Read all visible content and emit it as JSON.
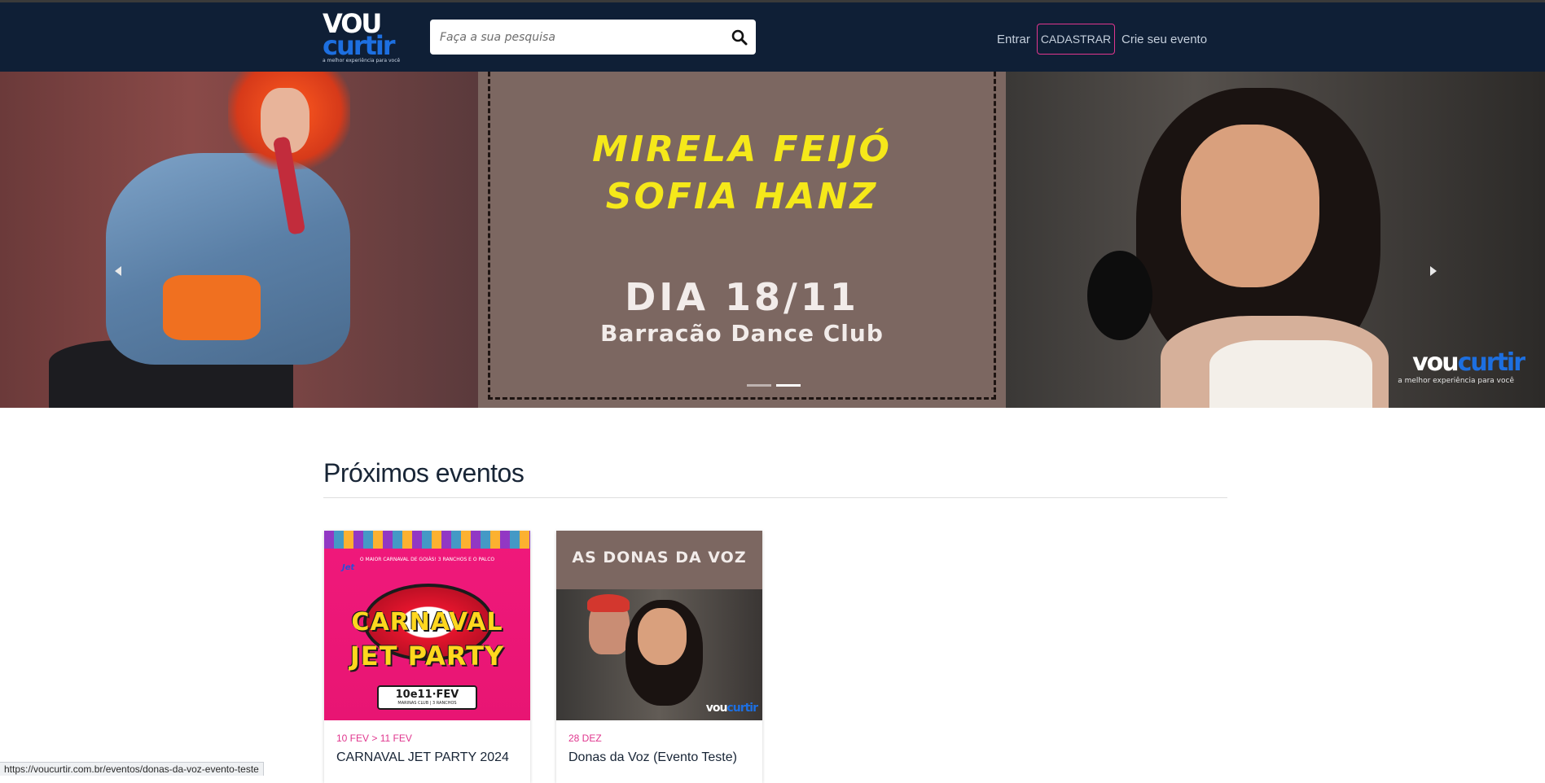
{
  "header": {
    "logo_top": "VOU",
    "logo_bottom": "curtir",
    "logo_tagline": "a melhor experiência para você",
    "search_placeholder": "Faça a sua pesquisa",
    "search_icon": "search-icon",
    "login_label": "Entrar",
    "register_label": "CADASTRAR",
    "create_event_label": "Crie seu evento",
    "background_color": "#0f1f36",
    "accent_color": "#e0368e"
  },
  "hero": {
    "name_1": "MIRELA FEIJÓ",
    "name_2": "SOFIA HANZ",
    "date": "DIA 18/11",
    "venue": "Barracão Dance Club",
    "watermark_a": "vou",
    "watermark_b": "curtir",
    "watermark_tagline": "a melhor experiência para você",
    "prev_icon": "chevron-left-icon",
    "next_icon": "chevron-right-icon",
    "slide_count": 2,
    "active_slide": 2
  },
  "events_section": {
    "title": "Próximos eventos",
    "cards": [
      {
        "date": "10 FEV > 11 FEV",
        "title": "CARNAVAL JET PARTY 2024",
        "art_line_1": "CARNAVAL",
        "art_line_2": "JET PARTY",
        "art_small": "O MAIOR CARNAVAL DE GOIÁS! 3 RANCHOS E O PALCO",
        "art_brand": "Jet",
        "art_date": "10e11·FEV",
        "art_date_sub": "MARINAS CLUB | 3 RANCHOS"
      },
      {
        "date": "28 DEZ",
        "title": "Donas da Voz (Evento Teste)",
        "art_title": "AS DONAS DA VOZ",
        "art_logo_a": "vou",
        "art_logo_b": "curtir"
      }
    ]
  },
  "status_bar": {
    "url": "https://voucurtir.com.br/eventos/donas-da-voz-evento-teste"
  }
}
